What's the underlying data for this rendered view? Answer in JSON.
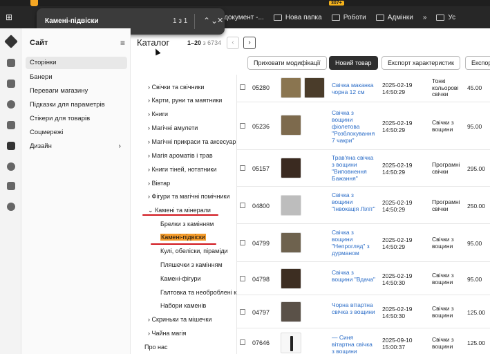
{
  "find_bar": {
    "query": "Камені-підвіски",
    "count": "1 з 1"
  },
  "bookmarks": [
    {
      "label": "документ -..."
    },
    {
      "label": "Нова папка"
    },
    {
      "label": "Роботи"
    },
    {
      "label": "Адмінки"
    },
    {
      "label": "»"
    },
    {
      "label": "Ус"
    }
  ],
  "bookmark_badge": "307+",
  "sidebar": {
    "title": "Сайт",
    "menu_icon": "≡",
    "items": [
      {
        "label": "Сторінки"
      },
      {
        "label": "Банери"
      },
      {
        "label": "Переваги магазину"
      },
      {
        "label": "Підказки для параметрів"
      },
      {
        "label": "Стікери для товарів"
      },
      {
        "label": "Соцмережі"
      },
      {
        "label": "Дизайн"
      }
    ]
  },
  "header": {
    "title": "Каталог",
    "range": "1–20",
    "of": "з 6734",
    "buttons": [
      "Приховати модифікації",
      "Новий товар",
      "Експорт характеристик",
      "Експор"
    ]
  },
  "tree": [
    {
      "label": "Свічки та свічники",
      "arrow": "›"
    },
    {
      "label": "Карти, руни та маятники",
      "arrow": "›"
    },
    {
      "label": "Книги",
      "arrow": "›"
    },
    {
      "label": "Магічні амулети",
      "arrow": "›"
    },
    {
      "label": "Магічні прикраси та аксесуари",
      "arrow": "›"
    },
    {
      "label": "Магія ароматів і трав",
      "arrow": "›"
    },
    {
      "label": "Книги тіней, нотатники",
      "arrow": "›"
    },
    {
      "label": "Вівтар",
      "arrow": "›"
    },
    {
      "label": "Фігури та магічні помічники",
      "arrow": "›"
    },
    {
      "label": "Камені та мінерали",
      "arrow": "⌄"
    },
    {
      "label": "Брелки з камінням"
    },
    {
      "label": "Камені-підвіски"
    },
    {
      "label": "Кулі, обеліски, піраміди"
    },
    {
      "label": "Пляшечки з камінням"
    },
    {
      "label": "Камені-фігури"
    },
    {
      "label": "Галтовка та необроблені камені"
    },
    {
      "label": "Набори каменів"
    },
    {
      "label": "Скриньки та мішечки",
      "arrow": "›"
    },
    {
      "label": "Чайна магія",
      "arrow": "›"
    },
    {
      "label": "Про нас"
    }
  ],
  "products": [
    {
      "sku": "05280",
      "name": "Свічка маканка чорна 12 см",
      "date": "2025-02-19 14:50:29",
      "category": "Тонкі кольорові свічки",
      "price": "45.00"
    },
    {
      "sku": "05236",
      "name": "Свічка з вощини фіолетова \"Розблокування 7 чакри\"",
      "date": "2025-02-19 14:50:29",
      "category": "Свічки з вощини",
      "price": "95.00"
    },
    {
      "sku": "05157",
      "name": "Трав'яна свічка з вощини \"Виповнення Бажання\"",
      "date": "2025-02-19 14:50:29",
      "category": "Програмні свічки",
      "price": "295.00"
    },
    {
      "sku": "04800",
      "name": "Свічка з вощини \"Інвокація Ліліт\"",
      "date": "2025-02-19 14:50:29",
      "category": "Програмні свічки",
      "price": "250.00"
    },
    {
      "sku": "04799",
      "name": "Свічка з вощини \"Непрогляд\" з дурманом",
      "date": "2025-02-19 14:50:29",
      "category": "Свічки з вощини",
      "price": "95.00"
    },
    {
      "sku": "04798",
      "name": "Свічка з вощини \"Вдача\"",
      "date": "2025-02-19 14:50:30",
      "category": "Свічки з вощини",
      "price": "95.00"
    },
    {
      "sku": "04797",
      "name": "Чорна вітартна свічка з вощини",
      "date": "2025-02-19 14:50:30",
      "category": "Свічки з вощини",
      "price": "125.00"
    },
    {
      "sku": "07646",
      "name": "— Синя вітартна свічка з вощини",
      "date": "2025-09-10 15:00:37",
      "category": "Свічки з вощини",
      "price": "125.00"
    }
  ],
  "colors": {
    "accent_highlight": "#f59c2b",
    "annotation_red": "#d0141b",
    "link": "#2a6cc7",
    "primary_button": "#2f2f2f"
  }
}
